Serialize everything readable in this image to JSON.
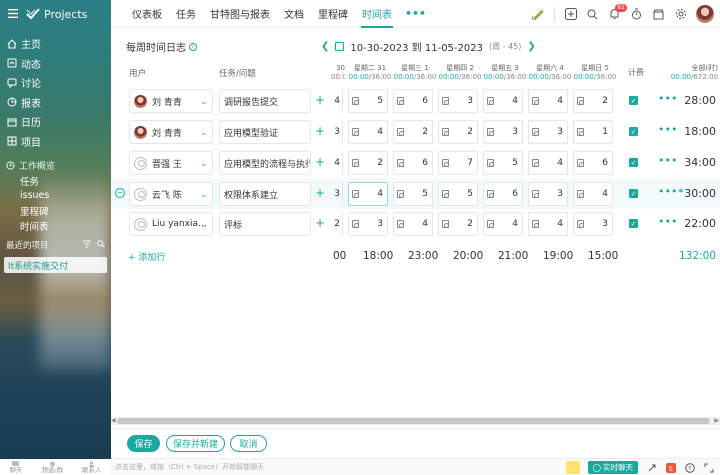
{
  "sidebar": {
    "brand": "Projects",
    "items": [
      {
        "label": "主页",
        "icon": "home-icon"
      },
      {
        "label": "动态",
        "icon": "activity-icon"
      },
      {
        "label": "讨论",
        "icon": "discussion-icon"
      },
      {
        "label": "报表",
        "icon": "report-icon"
      },
      {
        "label": "日历",
        "icon": "calendar-icon"
      },
      {
        "label": "项目",
        "icon": "project-icon"
      }
    ],
    "work_section": "工作概览",
    "sub_items": [
      "任务",
      "issues",
      "里程碑",
      "时间表"
    ],
    "recent_label": "最近的项目",
    "recent_project": "It系统实施交付",
    "footer": [
      "聊天",
      "频道/群",
      "联系人"
    ]
  },
  "nav": {
    "items": [
      "仪表板",
      "任务",
      "甘特图与报表",
      "文档",
      "里程碑",
      "时间表"
    ],
    "active_index": 5,
    "more": "•••",
    "notification_count": "81"
  },
  "timesheet": {
    "title": "每周时间日志",
    "range": "10-30-2023 到 11-05-2023",
    "week": "(周 - 45)",
    "col_user": "用户",
    "col_task": "任务/问题",
    "col_billable": "计费",
    "partial_day": "30",
    "partial_sub": "00:00/3",
    "days": [
      {
        "name": "星期二 31",
        "sub_a": "00:00",
        "sub_b": "/36:00"
      },
      {
        "name": "星期三 1",
        "sub_a": "00:00",
        "sub_b": "/36:00"
      },
      {
        "name": "星期四 2",
        "sub_a": "00:00",
        "sub_b": "/36:00"
      },
      {
        "name": "星期五 3",
        "sub_a": "00:00",
        "sub_b": "/36:00"
      },
      {
        "name": "星期六 4",
        "sub_a": "00:00",
        "sub_b": "/36:00"
      },
      {
        "name": "星期日 5",
        "sub_a": "00:00",
        "sub_b": "/36:00"
      }
    ],
    "total_header": "全部(时)",
    "total_sub_a": "00:00",
    "total_sub_b": "/672:00",
    "rows": [
      {
        "user": "刘 青青",
        "avatar": "photo",
        "task": "调研报告提交",
        "partial": "4",
        "values": [
          "5",
          "6",
          "3",
          "4",
          "4",
          "2"
        ],
        "billable": true,
        "total": "28:00"
      },
      {
        "user": "刘 青青",
        "avatar": "photo",
        "task": "应用模型验证",
        "partial": "3",
        "values": [
          "4",
          "2",
          "2",
          "3",
          "3",
          "1"
        ],
        "billable": true,
        "total": "18:00"
      },
      {
        "user": "晋强 王",
        "avatar": "default",
        "task": "应用模型的流程与执行",
        "partial": "4",
        "values": [
          "2",
          "6",
          "7",
          "5",
          "4",
          "6"
        ],
        "billable": true,
        "total": "34:00"
      },
      {
        "user": "云飞 陈",
        "avatar": "default",
        "task": "权限体系建立",
        "partial": "3",
        "values": [
          "4",
          "5",
          "5",
          "6",
          "3",
          "4"
        ],
        "billable": true,
        "total": "30:00"
      },
      {
        "user": "Liu yanxia...",
        "avatar": "default",
        "task": "评标",
        "partial": "2",
        "values": [
          "3",
          "4",
          "2",
          "4",
          "4",
          "3"
        ],
        "billable": true,
        "total": "22:00"
      }
    ],
    "add_row": "+ 添加行",
    "col_totals_partial": "00",
    "col_totals": [
      "18:00",
      "23:00",
      "20:00",
      "21:00",
      "19:00",
      "15:00"
    ],
    "grand_total": "132:00"
  },
  "actions": {
    "save": "保存",
    "save_new": "保存并新建",
    "cancel": "取消"
  },
  "chat": {
    "placeholder": "点击这里，或按（Ctrl + Space）开始智能聊天",
    "live_chat": "实时聊天"
  },
  "colors": {
    "accent": "#1ba99e",
    "badge": "#f04a4a"
  }
}
